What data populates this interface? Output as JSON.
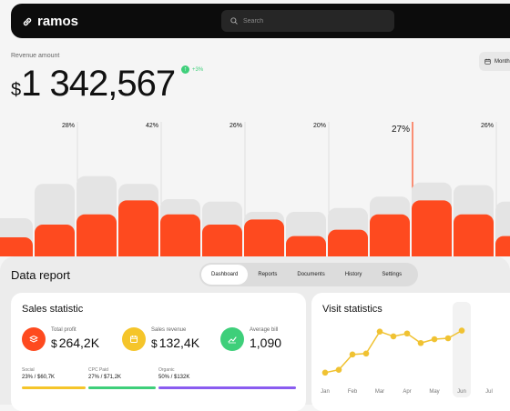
{
  "header": {
    "brand": "ramos",
    "search_placeholder": "Search"
  },
  "revenue": {
    "label": "Revenue amount",
    "currency": "$",
    "value": "1 342,567",
    "change": "+3%",
    "period_button": "Month"
  },
  "colors": {
    "accent": "#fe4a1f",
    "ghost": "#e4e4e4",
    "green": "#3ecf7a",
    "yellow": "#f5c52a",
    "purple": "#8a5cf0",
    "line": "#f0c232"
  },
  "chart_data": [
    {
      "type": "bar",
      "labels": [
        "28%",
        "42%",
        "26%",
        "20%",
        "27%",
        "26%"
      ],
      "highlighted": "27%",
      "ghost_bars": [
        30,
        57,
        63,
        57,
        45,
        43,
        35,
        35,
        38,
        47,
        58,
        56,
        43
      ],
      "bars": [
        15,
        25,
        33,
        44,
        33,
        25,
        29,
        16,
        21,
        33,
        44,
        33,
        16
      ]
    },
    {
      "type": "line",
      "title": "Visit statistics",
      "categories": [
        "Jan",
        "Feb",
        "Mar",
        "Apr",
        "May",
        "Jun",
        "Jul"
      ],
      "highlighted": "Jun",
      "points": [
        4,
        7,
        23,
        24,
        47,
        42,
        45,
        35,
        39,
        40,
        48
      ]
    }
  ],
  "data_report": {
    "title": "Data report",
    "tabs": [
      "Dashboard",
      "Reports",
      "Documents",
      "History",
      "Settings"
    ],
    "active_tab": "Dashboard"
  },
  "sales": {
    "title": "Sales statistic",
    "stats": [
      {
        "label": "Total profit",
        "currency": "$",
        "value": "264,2K",
        "icon": "stack-icon",
        "color": "#fe4a1f"
      },
      {
        "label": "Sales revenue",
        "currency": "$",
        "value": "132,4K",
        "icon": "calendar-icon",
        "color": "#f5c52a"
      },
      {
        "label": "Average bill",
        "currency": "",
        "value": "1,090",
        "icon": "trend-icon",
        "color": "#3ecf7a"
      }
    ],
    "subs": [
      {
        "label": "Social",
        "value": "23% / $60,7K",
        "color": "#f5c52a"
      },
      {
        "label": "CPC Paid",
        "value": "27% / $71,2K",
        "color": "#3ecf7a"
      },
      {
        "label": "Organic",
        "value": "50% / $132K",
        "color": "#8a5cf0"
      }
    ]
  }
}
